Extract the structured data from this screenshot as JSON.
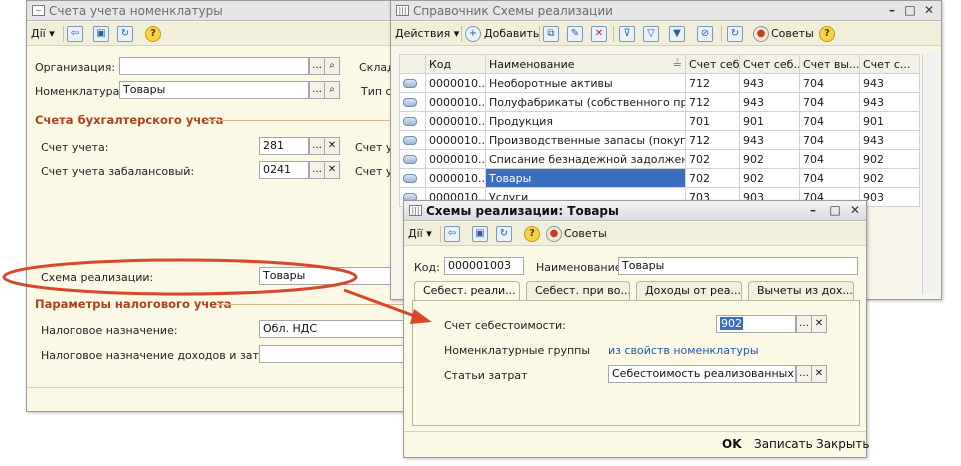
{
  "win1": {
    "title": "Счета учета номенклатуры",
    "toolbar": {
      "actions": "Дії ▾"
    },
    "fields": {
      "org_label": "Организация:",
      "org_value": "",
      "nom_label": "Номенклатура:",
      "nom_value": "Товары",
      "sklad_label": "Склад",
      "tip_label": "Тип с"
    },
    "section_accounting": "Счета бухгалтерского учета",
    "account_label": "Счет учета:",
    "account_value": "281",
    "offbalance_label": "Счет учета забалансовый:",
    "offbalance_value": "0241",
    "side_labels": [
      "Счет у",
      "Счет у"
    ],
    "scheme_label": "Схема реализации:",
    "scheme_value": "Товары",
    "section_tax": "Параметры налогового учета",
    "tax_purpose_label": "Налоговое назначение:",
    "tax_purpose_value": "Обл. НДС",
    "tax_income_label": "Налоговое назначение доходов и затрат:",
    "tax_income_value": ""
  },
  "win2": {
    "title": "Справочник Схемы реализации",
    "toolbar": {
      "actions": "Действия ▾",
      "add": "Добавить",
      "tips": "Советы"
    },
    "columns": [
      "Код",
      "Наименование",
      "Счет себ...",
      "Счет себ...",
      "Счет вы...",
      "Счет с..."
    ],
    "rows": [
      [
        "0000010...",
        "Необоротные активы",
        "712",
        "943",
        "704",
        "943"
      ],
      [
        "0000010...",
        "Полуфабрикаты (собственного про...",
        "712",
        "943",
        "704",
        "943"
      ],
      [
        "0000010...",
        "Продукция",
        "701",
        "901",
        "704",
        "901"
      ],
      [
        "0000010...",
        "Производственные запасы (покупн...",
        "712",
        "943",
        "704",
        "943"
      ],
      [
        "0000010...",
        "Списание безнадежной задолжен...",
        "702",
        "902",
        "704",
        "902"
      ],
      [
        "0000010...",
        "Товары",
        "702",
        "902",
        "704",
        "902"
      ],
      [
        "0000010...",
        "Услуги",
        "703",
        "903",
        "704",
        "903"
      ]
    ]
  },
  "win3": {
    "title": "Схемы реализации: Товары",
    "toolbar": {
      "actions": "Дії ▾",
      "tips": "Советы"
    },
    "code_label": "Код:",
    "code_value": "000001003",
    "name_label": "Наименование:",
    "name_value": "Товары",
    "tabs": [
      "Себест. реали...",
      "Себест. при во...",
      "Доходы от реа...",
      "Вычеты из дох..."
    ],
    "cost_account_label": "Счет себестоимости:",
    "cost_account_value": "902",
    "nom_groups_label": "Номенклатурные группы",
    "nom_groups_link": "из свойств номенклатуры",
    "expense_label": "Статьи затрат",
    "expense_value": "Себестоимость реализованных пок",
    "buttons": {
      "ok": "OK",
      "save": "Записать",
      "close": "Закрыть"
    }
  },
  "colors": {
    "highlight_ellipse": "#d9472a",
    "arrow": "#d9472a",
    "section_text": "#a8431c",
    "selection": "#3a6fbf"
  }
}
